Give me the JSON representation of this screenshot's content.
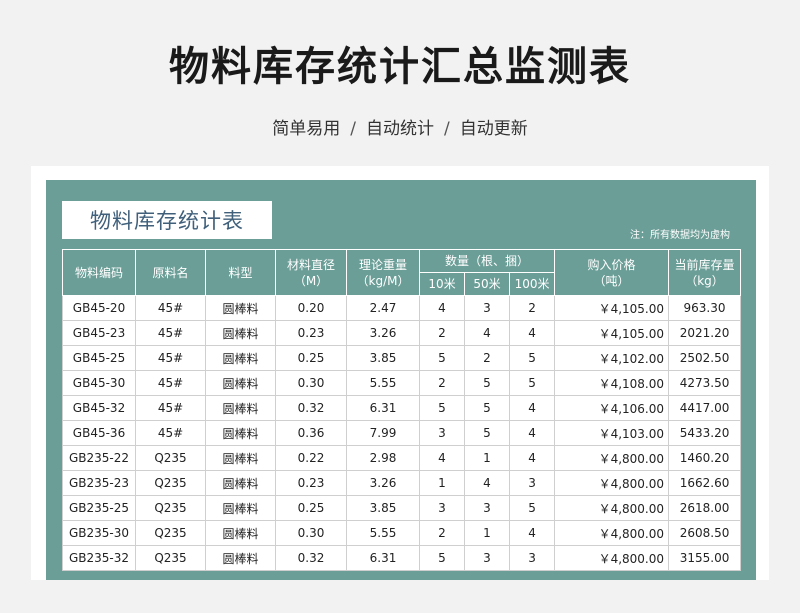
{
  "page": {
    "title": "物料库存统计汇总监测表",
    "subtitle": [
      "简单易用",
      "自动统计",
      "自动更新"
    ],
    "subtitle_sep": "/"
  },
  "sheet": {
    "title": "物料库存统计表",
    "note": "注：所有数据均为虚构",
    "colors": {
      "header_bg": "#6b9e97",
      "title_text": "#3f5f7a"
    }
  },
  "table": {
    "headers": {
      "code": "物料编码",
      "material": "原料名",
      "type": "料型",
      "diameter": "材料直径\n（M）",
      "weight": "理论重量\n（kg/M）",
      "qty_group": "数量（根、捆）",
      "qty_10": "10米",
      "qty_50": "50米",
      "qty_100": "100米",
      "price": "购入价格\n（吨）",
      "stock": "当前库存量\n（kg）"
    },
    "rows": [
      [
        "GB45-20",
        "45#",
        "圆棒料",
        "0.20",
        "2.47",
        "4",
        "3",
        "2",
        "￥4,105.00",
        "963.30"
      ],
      [
        "GB45-23",
        "45#",
        "圆棒料",
        "0.23",
        "3.26",
        "2",
        "4",
        "4",
        "￥4,105.00",
        "2021.20"
      ],
      [
        "GB45-25",
        "45#",
        "圆棒料",
        "0.25",
        "3.85",
        "5",
        "2",
        "5",
        "￥4,102.00",
        "2502.50"
      ],
      [
        "GB45-30",
        "45#",
        "圆棒料",
        "0.30",
        "5.55",
        "2",
        "5",
        "5",
        "￥4,108.00",
        "4273.50"
      ],
      [
        "GB45-32",
        "45#",
        "圆棒料",
        "0.32",
        "6.31",
        "5",
        "5",
        "4",
        "￥4,106.00",
        "4417.00"
      ],
      [
        "GB45-36",
        "45#",
        "圆棒料",
        "0.36",
        "7.99",
        "3",
        "5",
        "4",
        "￥4,103.00",
        "5433.20"
      ],
      [
        "GB235-22",
        "Q235",
        "圆棒料",
        "0.22",
        "2.98",
        "4",
        "1",
        "4",
        "￥4,800.00",
        "1460.20"
      ],
      [
        "GB235-23",
        "Q235",
        "圆棒料",
        "0.23",
        "3.26",
        "1",
        "4",
        "3",
        "￥4,800.00",
        "1662.60"
      ],
      [
        "GB235-25",
        "Q235",
        "圆棒料",
        "0.25",
        "3.85",
        "3",
        "3",
        "5",
        "￥4,800.00",
        "2618.00"
      ],
      [
        "GB235-30",
        "Q235",
        "圆棒料",
        "0.30",
        "5.55",
        "2",
        "1",
        "4",
        "￥4,800.00",
        "2608.50"
      ],
      [
        "GB235-32",
        "Q235",
        "圆棒料",
        "0.32",
        "6.31",
        "5",
        "3",
        "3",
        "￥4,800.00",
        "3155.00"
      ]
    ]
  }
}
